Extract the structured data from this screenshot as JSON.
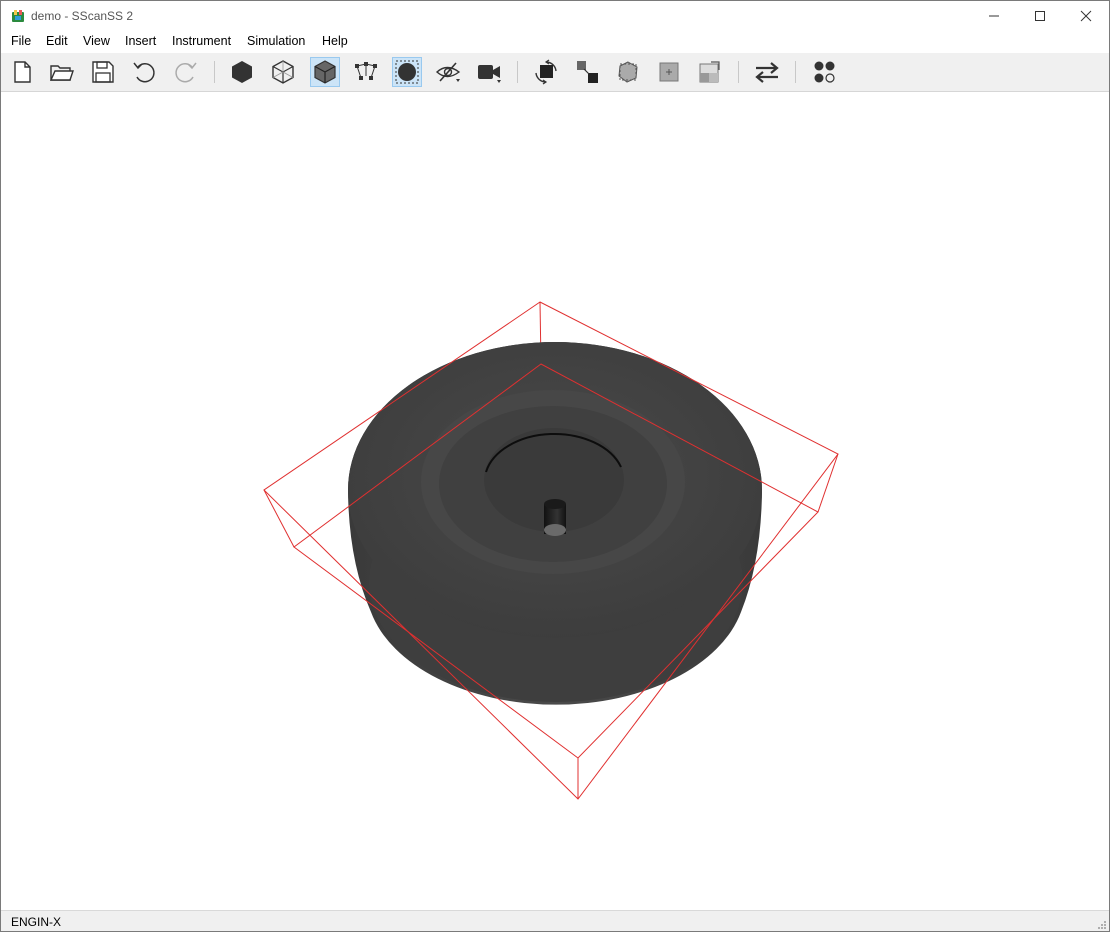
{
  "window": {
    "title": "demo - SScanSS 2",
    "icon": "sscanss-app-icon"
  },
  "titlebar_controls": [
    "minimize-icon",
    "maximize-icon",
    "close-icon"
  ],
  "menu": {
    "items": [
      "File",
      "Edit",
      "View",
      "Insert",
      "Instrument",
      "Simulation",
      "Help"
    ]
  },
  "toolbar": {
    "buttons": [
      {
        "icon": "new-file-icon",
        "active": false
      },
      {
        "icon": "open-folder-icon",
        "active": false
      },
      {
        "icon": "save-icon",
        "active": false
      },
      {
        "icon": "undo-icon",
        "active": false
      },
      {
        "icon": "redo-icon",
        "active": false
      },
      {
        "icon": "solid-render-icon",
        "active": false
      },
      {
        "icon": "wireframe-render-icon",
        "active": false
      },
      {
        "icon": "transparent-render-icon",
        "active": true
      },
      {
        "icon": "toggle-points-icon",
        "active": false
      },
      {
        "icon": "toggle-bounding-box-icon",
        "active": true
      },
      {
        "icon": "visibility-icon",
        "active": false
      },
      {
        "icon": "camera-icon",
        "active": false
      },
      {
        "icon": "rotate-sample-icon",
        "active": false
      },
      {
        "icon": "translate-sample-icon",
        "active": false
      },
      {
        "icon": "transform-matrix-icon",
        "active": false
      },
      {
        "icon": "move-origin-icon",
        "active": false
      },
      {
        "icon": "plane-align-icon",
        "active": false
      },
      {
        "icon": "swap-positioner-icon",
        "active": false
      },
      {
        "icon": "positioner-control-icon",
        "active": false
      }
    ],
    "accent_active": "#cce4f7"
  },
  "scene": {
    "model": "disc-sample",
    "model_color": "#3c3c3c",
    "bounding_box_color": "#e03030"
  },
  "status": {
    "instrument": "ENGIN-X"
  }
}
